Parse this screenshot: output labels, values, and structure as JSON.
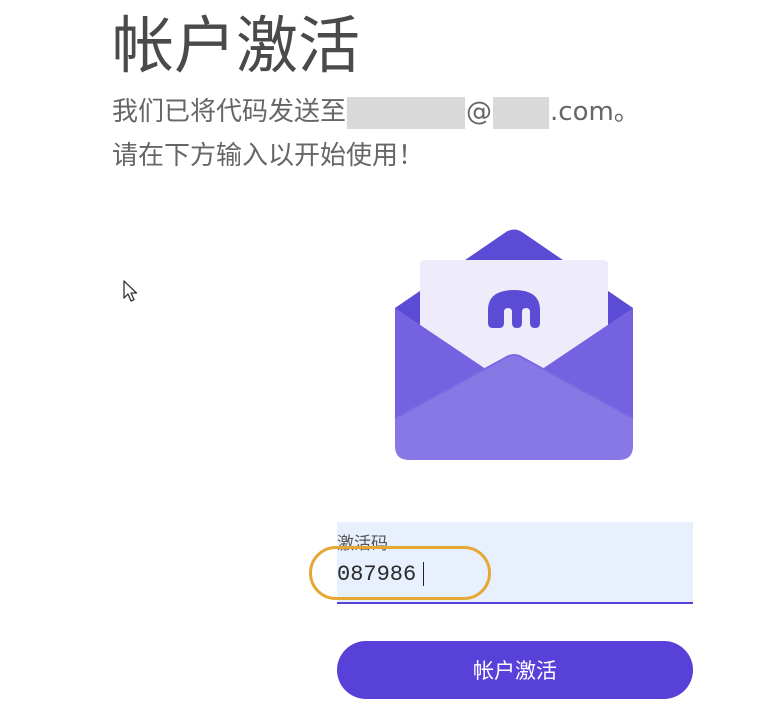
{
  "page": {
    "title": "帐户激活",
    "subtitle_line1_prefix": "我们已将代码发送至",
    "subtitle_line1_at": "@",
    "subtitle_line1_suffix": ".com。",
    "subtitle_line2": "请在下方输入以开始使用！"
  },
  "form": {
    "field_label": "激活码",
    "field_value": "087986",
    "submit_label": "帐户激活"
  },
  "colors": {
    "brand_purple": "#5741d9",
    "highlight_orange": "#e5a832",
    "field_background": "#e8effd"
  },
  "icons": {
    "envelope": "envelope-with-letter-icon",
    "brand_logo": "kraken-logo-icon",
    "cursor": "mouse-pointer-icon"
  }
}
